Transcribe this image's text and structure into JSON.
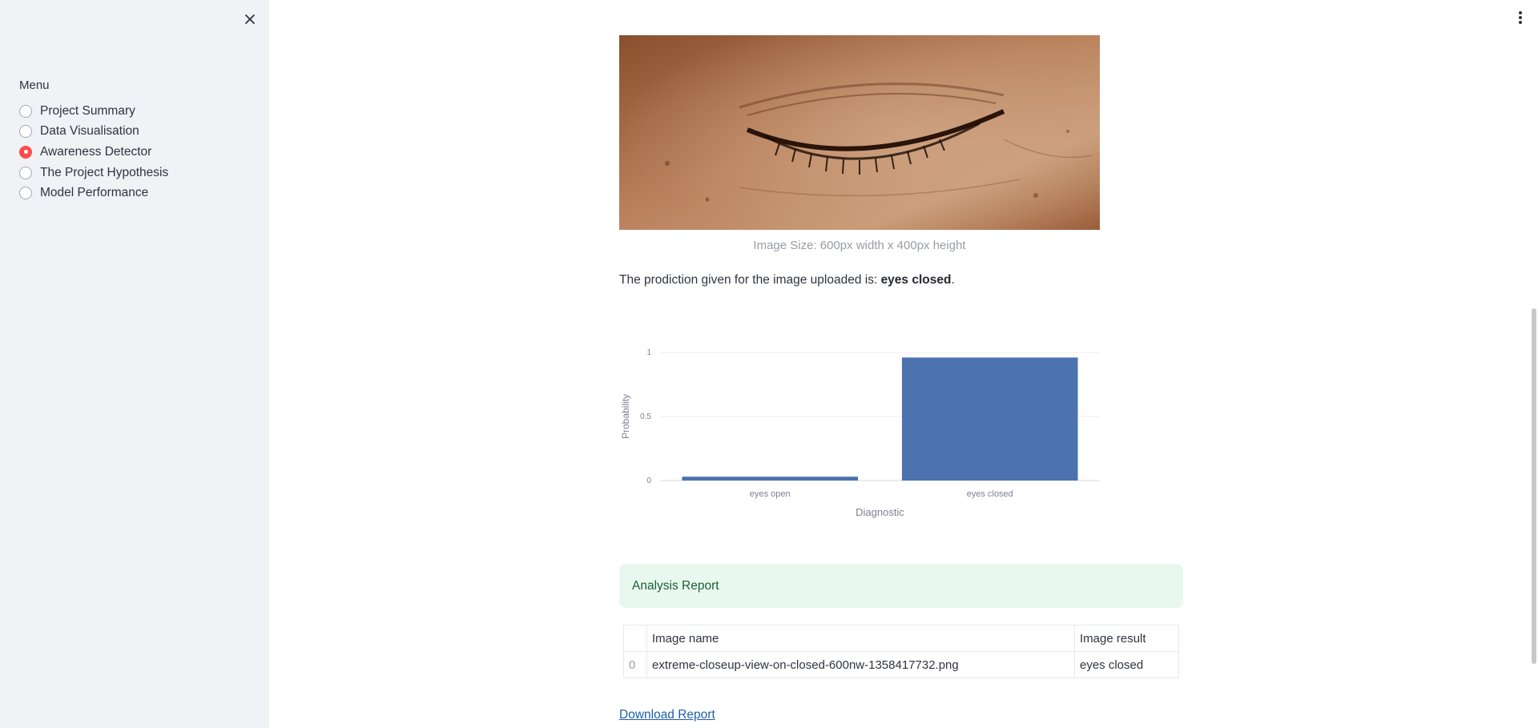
{
  "sidebar": {
    "menu_label": "Menu",
    "items": [
      {
        "label": "Project Summary",
        "selected": false
      },
      {
        "label": "Data Visualisation",
        "selected": false
      },
      {
        "label": "Awareness Detector",
        "selected": true
      },
      {
        "label": "The Project Hypothesis",
        "selected": false
      },
      {
        "label": "Model Performance",
        "selected": false
      }
    ],
    "close_icon": "close-icon"
  },
  "main": {
    "image_caption": "Image Size: 600px width x 400px height",
    "prediction_prefix": "The prodiction given for the image uploaded is: ",
    "prediction_value": "eyes closed",
    "prediction_suffix": ".",
    "alert_text": "Analysis Report",
    "table": {
      "headers": [
        "",
        "Image name",
        "Image result"
      ],
      "rows": [
        {
          "index": "0",
          "name": "extreme-closeup-view-on-closed-600nw-1358417732.png",
          "result": "eyes closed"
        }
      ]
    },
    "download_label": "Download Report",
    "menu_icon": "kebab-menu-icon"
  },
  "colors": {
    "accent": "#FF4B4B",
    "bar": "#4C72B0",
    "alert_bg": "#E9F8EE",
    "alert_text": "#1A6132",
    "link": "#1F5FA8"
  },
  "chart_data": {
    "type": "bar",
    "categories": [
      "eyes open",
      "eyes closed"
    ],
    "values": [
      0.03,
      0.96
    ],
    "xlabel": "Diagnostic",
    "ylabel": "Probability",
    "yticks": [
      "0",
      "0.5",
      "1"
    ],
    "ylim": [
      0,
      1
    ],
    "grid": true
  }
}
